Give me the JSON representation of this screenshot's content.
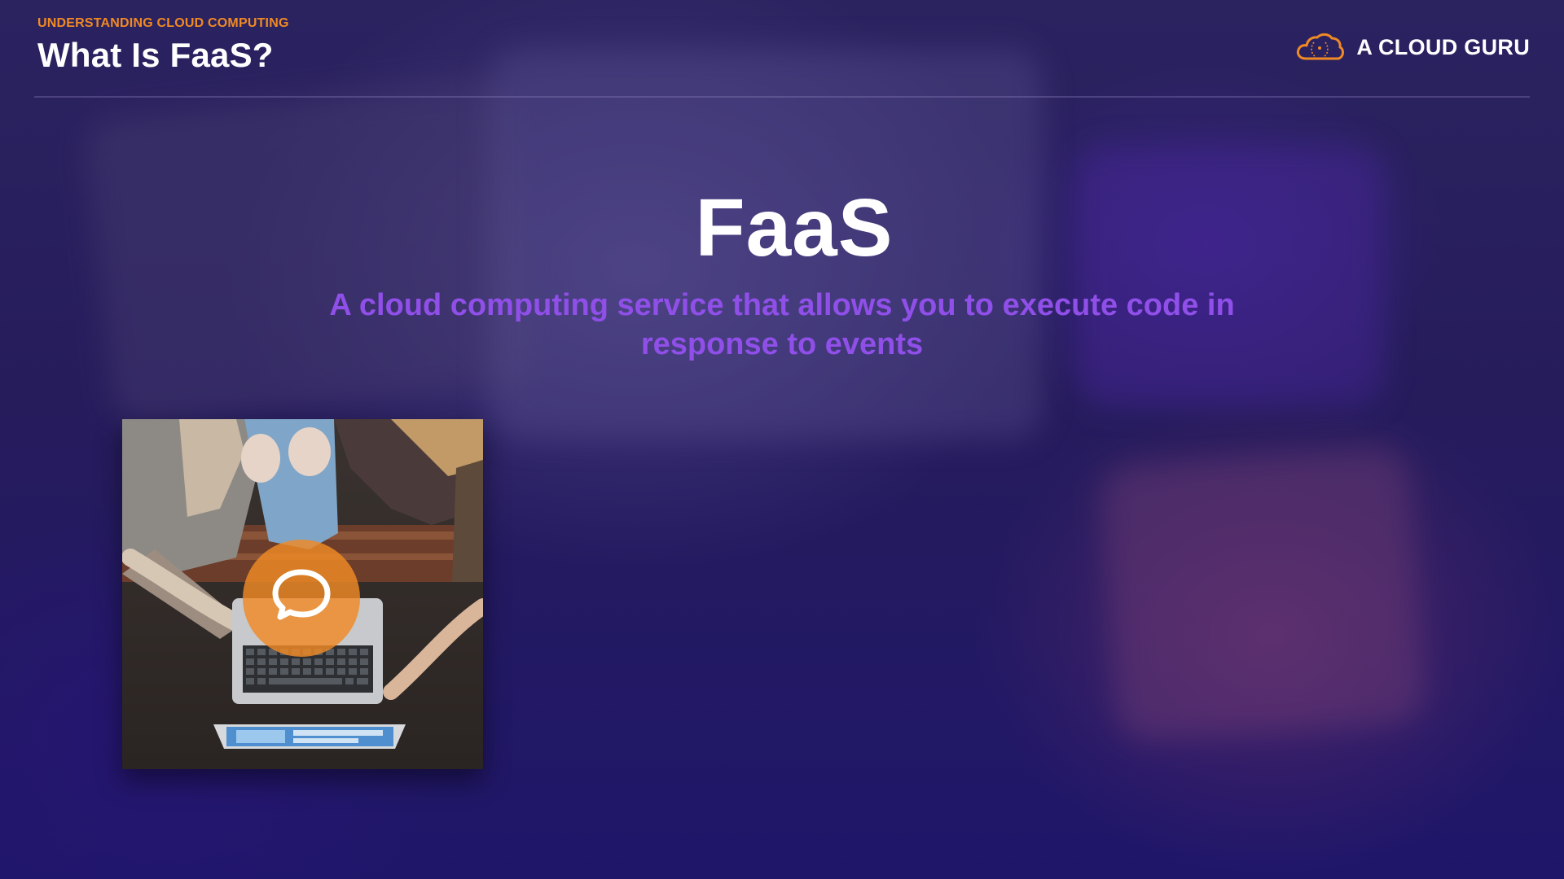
{
  "header": {
    "kicker": "UNDERSTANDING CLOUD COMPUTING",
    "title": "What Is FaaS?"
  },
  "brand": {
    "name": "A CLOUD GURU",
    "icon": "cloud-logo-icon"
  },
  "hero": {
    "term": "FaaS",
    "definition": "A cloud computing service that allows you to execute code in response to events"
  },
  "illustration": {
    "subject": "people using a laptop and tablet",
    "overlay_icon": "chat-bubble-icon"
  },
  "colors": {
    "accent_orange": "#f08a24",
    "definition_purple": "#8f4fe8",
    "title_white": "#ffffff",
    "background_navy": "#221a52"
  }
}
